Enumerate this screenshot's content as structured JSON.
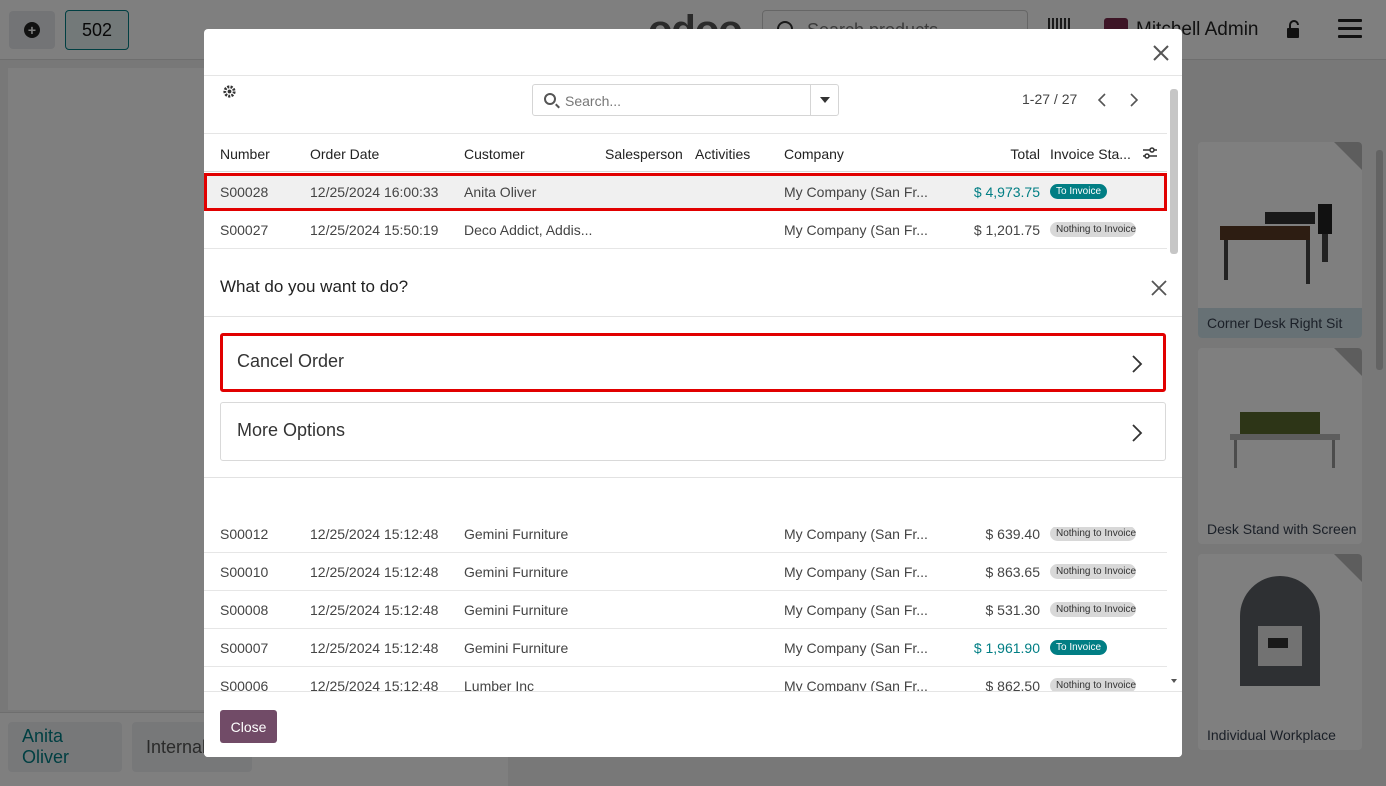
{
  "header": {
    "order_number": "502",
    "logo": "odoo",
    "search_placeholder": "Search products...",
    "user_name": "Mitchell Admin"
  },
  "left_bottom": {
    "customer": "Anita Oliver",
    "internal_note": "Internal"
  },
  "products": [
    {
      "name": "Corner Desk Right Sit",
      "selected": true
    },
    {
      "name": "Desk Stand with Screen",
      "selected": false
    },
    {
      "name": "Individual Workplace",
      "selected": false
    }
  ],
  "orders_dialog": {
    "search_placeholder": "Search...",
    "pager": "1-27 / 27",
    "columns": [
      "Number",
      "Order Date",
      "Customer",
      "Salesperson",
      "Activities",
      "Company",
      "Total",
      "Invoice Sta..."
    ],
    "rows": [
      {
        "number": "S00028",
        "date": "12/25/2024 16:00:33",
        "customer": "Anita Oliver",
        "company": "My Company (San Fr...",
        "total": "$ 4,973.75",
        "invoice": "To Invoice"
      },
      {
        "number": "S00027",
        "date": "12/25/2024 15:50:19",
        "customer": "Deco Addict, Addis...",
        "company": "My Company (San Fr...",
        "total": "$ 1,201.75",
        "invoice": "Nothing to Invoice"
      },
      {
        "number": "S00012",
        "date": "12/25/2024 15:12:48",
        "customer": "Gemini Furniture",
        "company": "My Company (San Fr...",
        "total": "$ 639.40",
        "invoice": "Nothing to Invoice"
      },
      {
        "number": "S00010",
        "date": "12/25/2024 15:12:48",
        "customer": "Gemini Furniture",
        "company": "My Company (San Fr...",
        "total": "$ 863.65",
        "invoice": "Nothing to Invoice"
      },
      {
        "number": "S00008",
        "date": "12/25/2024 15:12:48",
        "customer": "Gemini Furniture",
        "company": "My Company (San Fr...",
        "total": "$ 531.30",
        "invoice": "Nothing to Invoice"
      },
      {
        "number": "S00007",
        "date": "12/25/2024 15:12:48",
        "customer": "Gemini Furniture",
        "company": "My Company (San Fr...",
        "total": "$ 1,961.90",
        "invoice": "To Invoice"
      },
      {
        "number": "S00006",
        "date": "12/25/2024 15:12:48",
        "customer": "Lumber Inc",
        "company": "My Company (San Fr...",
        "total": "$ 862.50",
        "invoice": "Nothing to Invoice"
      }
    ],
    "close_label": "Close"
  },
  "action_popup": {
    "title": "What do you want to do?",
    "options": [
      "Cancel Order",
      "More Options"
    ]
  },
  "colors": {
    "accent": "#017e84",
    "primary_button": "#714b67",
    "highlight": "#e10000"
  }
}
